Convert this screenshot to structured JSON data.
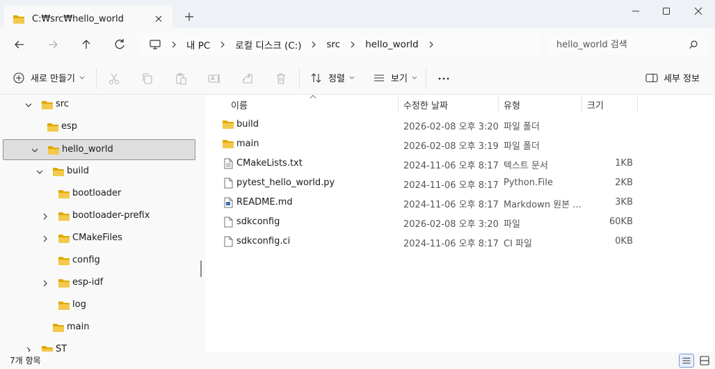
{
  "tab": {
    "title": "C:₩src₩hello_world"
  },
  "address": {
    "crumbs": [
      "내 PC",
      "로컬 디스크 (C:)",
      "src",
      "hello_world"
    ]
  },
  "search": {
    "placeholder": "hello_world 검색"
  },
  "toolbar": {
    "new_label": "새로 만들기",
    "sort_label": "정렬",
    "view_label": "보기",
    "details_label": "세부 정보"
  },
  "sidebar": {
    "items": [
      {
        "label": "src",
        "depth": 0,
        "expander": "expanded"
      },
      {
        "label": "esp",
        "depth": 1,
        "expander": "none"
      },
      {
        "label": "hello_world",
        "depth": 1,
        "expander": "expanded",
        "selected": true
      },
      {
        "label": "build",
        "depth": 2,
        "expander": "expanded"
      },
      {
        "label": "bootloader",
        "depth": 3,
        "expander": "none"
      },
      {
        "label": "bootloader-prefix",
        "depth": 3,
        "expander": "collapsed"
      },
      {
        "label": "CMakeFiles",
        "depth": 3,
        "expander": "collapsed"
      },
      {
        "label": "config",
        "depth": 3,
        "expander": "none"
      },
      {
        "label": "esp-idf",
        "depth": 3,
        "expander": "collapsed"
      },
      {
        "label": "log",
        "depth": 3,
        "expander": "none"
      },
      {
        "label": "main",
        "depth": 2,
        "expander": "none"
      },
      {
        "label": "ST",
        "depth": 0,
        "expander": "collapsed"
      }
    ]
  },
  "columns": {
    "name": "이름",
    "date": "수정한 날짜",
    "type": "유형",
    "size": "크기"
  },
  "files": [
    {
      "name": "build",
      "date": "2026-02-08 오후 3:20",
      "type": "파일 폴더",
      "size": "",
      "icon": "folder-icon"
    },
    {
      "name": "main",
      "date": "2026-02-08 오후 3:19",
      "type": "파일 폴더",
      "size": "",
      "icon": "folder-icon"
    },
    {
      "name": "CMakeLists.txt",
      "date": "2024-11-06 오후 8:17",
      "type": "텍스트 문서",
      "size": "1KB",
      "icon": "text-file-icon"
    },
    {
      "name": "pytest_hello_world.py",
      "date": "2024-11-06 오후 8:17",
      "type": "Python.File",
      "size": "2KB",
      "icon": "file-icon"
    },
    {
      "name": "README.md",
      "date": "2024-11-06 오후 8:17",
      "type": "Markdown 원본 ...",
      "size": "3KB",
      "icon": "markdown-file-icon"
    },
    {
      "name": "sdkconfig",
      "date": "2026-02-08 오후 3:20",
      "type": "파일",
      "size": "60KB",
      "icon": "file-icon"
    },
    {
      "name": "sdkconfig.ci",
      "date": "2024-11-06 오후 8:17",
      "type": "CI 파일",
      "size": "0KB",
      "icon": "file-icon"
    }
  ],
  "status": {
    "count": "7개 항목"
  },
  "colors": {
    "folder": "#f2c94c",
    "folder_dark": "#e0a800",
    "accent": "#0067c0",
    "selection": "#dedede"
  }
}
